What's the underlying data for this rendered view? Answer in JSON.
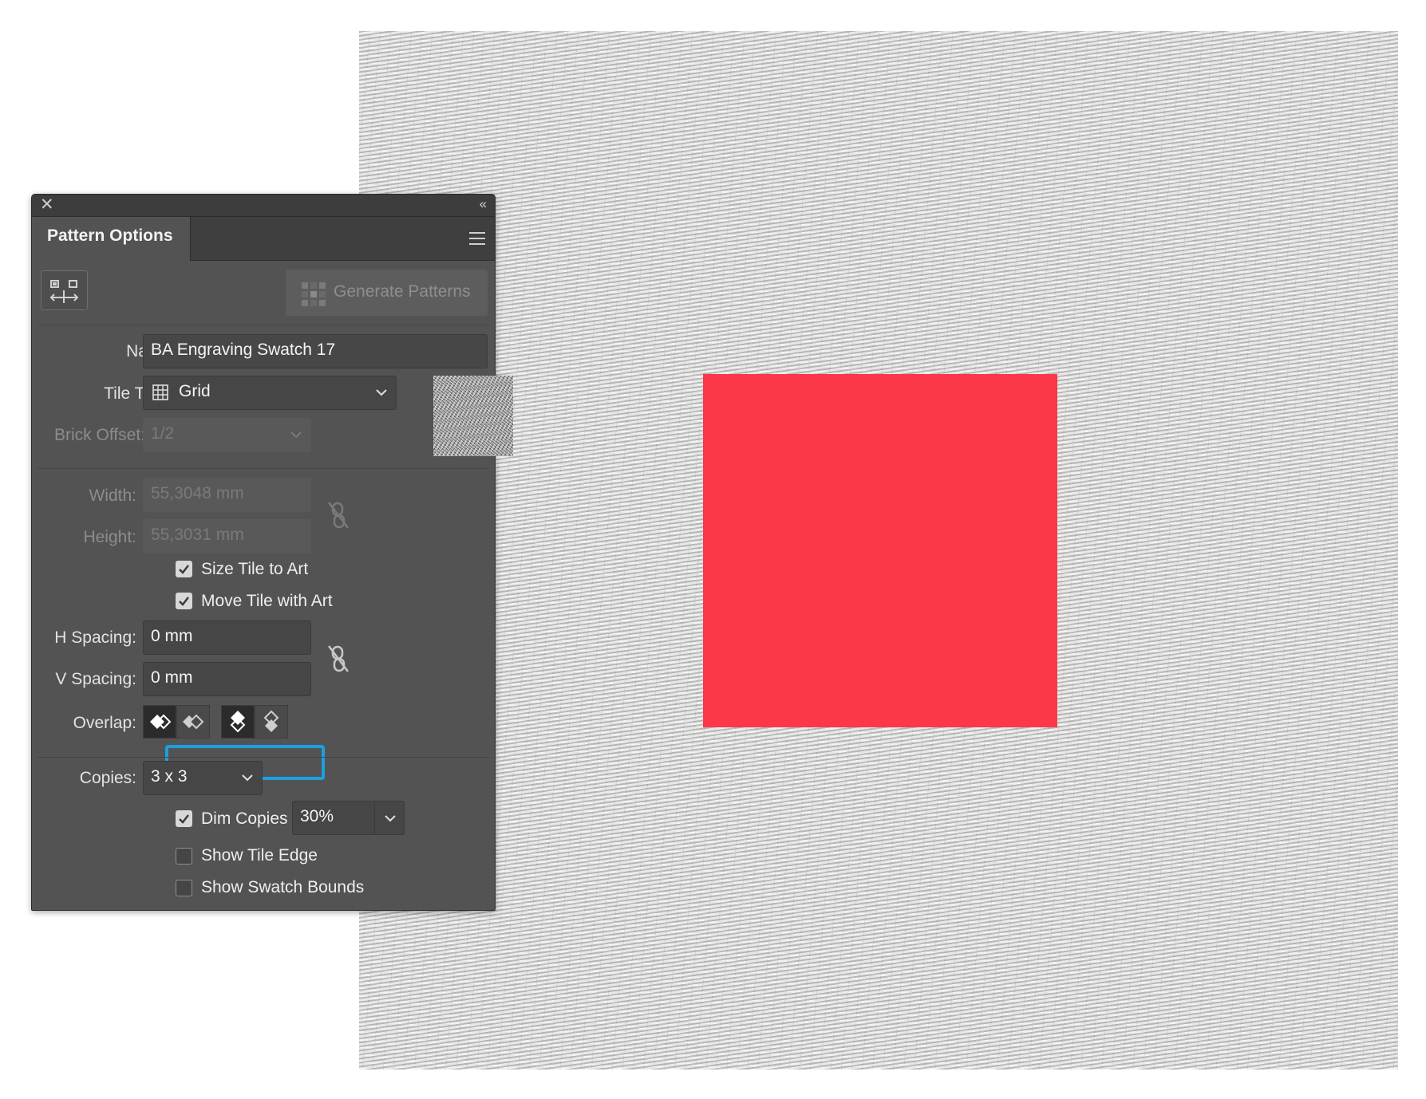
{
  "panel": {
    "title": "Pattern Options",
    "generate_label": "Generate Patterns",
    "name_label": "Name:",
    "name_value": "BA Engraving Swatch 17",
    "tile_type_label": "Tile Type:",
    "tile_type_value": "Grid",
    "brick_offset_label": "Brick Offset:",
    "brick_offset_value": "1/2",
    "width_label": "Width:",
    "width_value": "55,3048 mm",
    "height_label": "Height:",
    "height_value": "55,3031 mm",
    "size_tile_label": "Size Tile to Art",
    "size_tile_checked": true,
    "move_tile_label": "Move Tile with Art",
    "move_tile_checked": true,
    "h_spacing_label": "H Spacing:",
    "h_spacing_value": "0 mm",
    "v_spacing_label": "V Spacing:",
    "v_spacing_value": "0 mm",
    "overlap_label": "Overlap:",
    "copies_label": "Copies:",
    "copies_value": "3 x 3",
    "dim_copies_label": "Dim Copies to:",
    "dim_copies_checked": true,
    "dim_copies_value": "30%",
    "show_tile_edge_label": "Show Tile Edge",
    "show_tile_edge_checked": false,
    "show_swatch_bounds_label": "Show Swatch Bounds",
    "show_swatch_bounds_checked": false
  },
  "icons": {
    "close": "close-icon",
    "collapse": "collapse-icon",
    "menu": "panel-menu-icon",
    "tile_tool": "pattern-tile-tool-icon",
    "grid": "grid-icon",
    "link": "chain-link-icon"
  },
  "colors": {
    "panel_bg": "#535353",
    "highlight": "#1ba0df",
    "art_fill": "#fc3747"
  }
}
